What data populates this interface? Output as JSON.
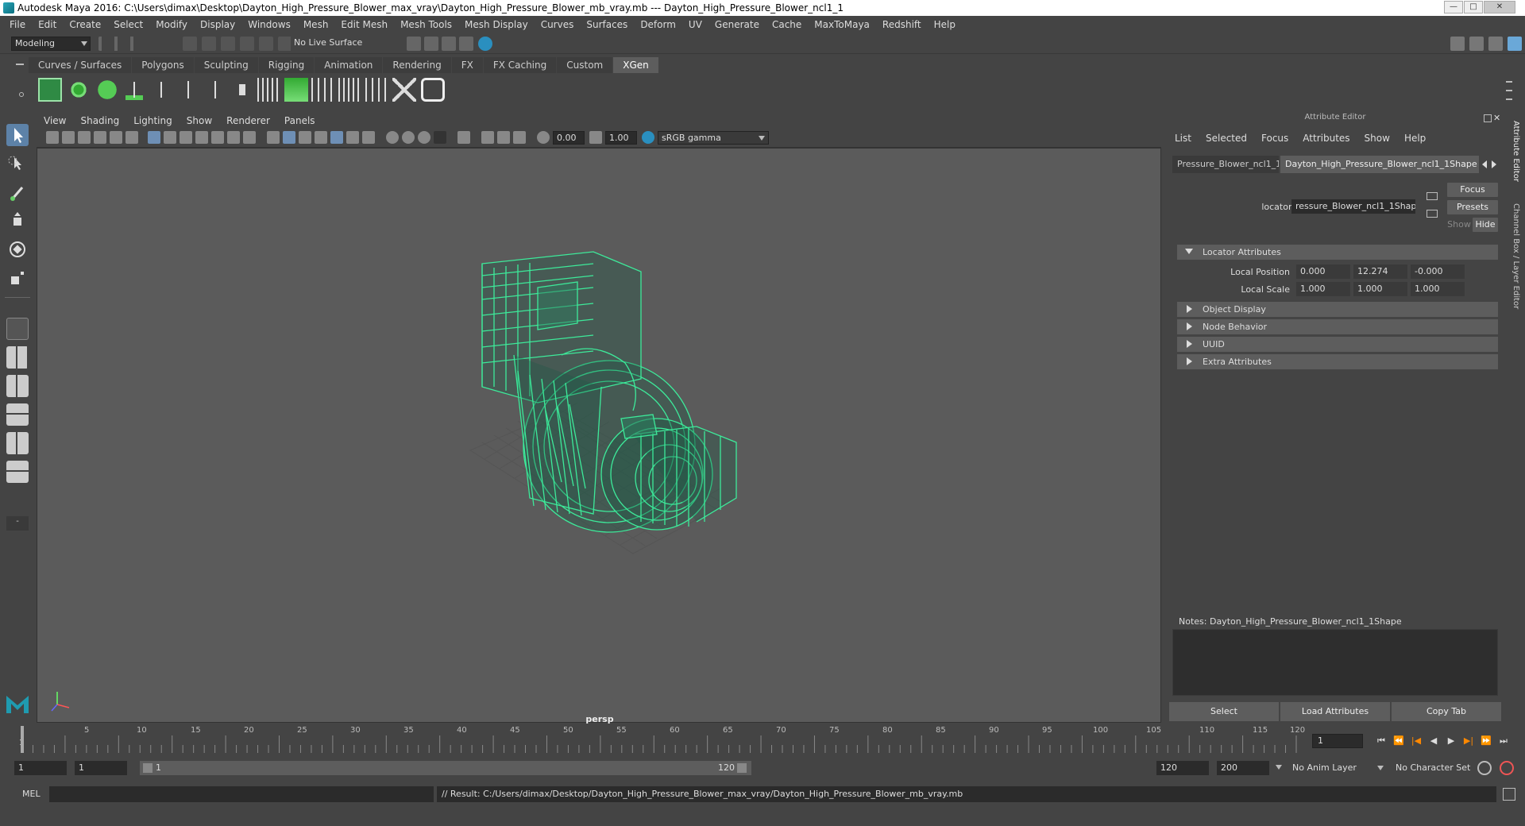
{
  "window": {
    "title": "Autodesk Maya 2016: C:\\Users\\dimax\\Desktop\\Dayton_High_Pressure_Blower_max_vray\\Dayton_High_Pressure_Blower_mb_vray.mb   ---   Dayton_High_Pressure_Blower_ncl1_1",
    "minimize": "—",
    "maximize": "□",
    "close": "✕"
  },
  "menubar": [
    "File",
    "Edit",
    "Create",
    "Select",
    "Modify",
    "Display",
    "Windows",
    "Mesh",
    "Edit Mesh",
    "Mesh Tools",
    "Mesh Display",
    "Curves",
    "Surfaces",
    "Deform",
    "UV",
    "Generate",
    "Cache",
    "MaxToMaya",
    "Redshift",
    "Help"
  ],
  "status": {
    "mode": "Modeling",
    "live_surface": "No Live Surface"
  },
  "shelf_tabs": [
    "Curves / Surfaces",
    "Polygons",
    "Sculpting",
    "Rigging",
    "Animation",
    "Rendering",
    "FX",
    "FX Caching",
    "Custom",
    "XGen"
  ],
  "shelf_active": "XGen",
  "viewport": {
    "menu": [
      "View",
      "Shading",
      "Lighting",
      "Show",
      "Renderer",
      "Panels"
    ],
    "exposure": "0.00",
    "gamma": "1.00",
    "color_space": "sRGB gamma",
    "camera_label": "persp"
  },
  "attr_editor": {
    "title": "Attribute Editor",
    "menu": [
      "List",
      "Selected",
      "Focus",
      "Attributes",
      "Show",
      "Help"
    ],
    "tab1": "Pressure_Blower_ncl1_1",
    "tab2": "Dayton_High_Pressure_Blower_ncl1_1Shape",
    "locator_label": "locator:",
    "locator_value": "ressure_Blower_ncl1_1Shape",
    "btn_focus": "Focus",
    "btn_presets": "Presets",
    "btn_show": "Show",
    "btn_hide": "Hide",
    "sections": {
      "locator_attrs": "Locator Attributes",
      "object_display": "Object Display",
      "node_behavior": "Node Behavior",
      "uuid": "UUID",
      "extra": "Extra Attributes"
    },
    "local_position_label": "Local Position",
    "local_position": [
      "0.000",
      "12.274",
      "-0.000"
    ],
    "local_scale_label": "Local Scale",
    "local_scale": [
      "1.000",
      "1.000",
      "1.000"
    ],
    "notes_label": "Notes:  Dayton_High_Pressure_Blower_ncl1_1Shape",
    "btn_select": "Select",
    "btn_load": "Load Attributes",
    "btn_copy": "Copy Tab"
  },
  "side_tabs": [
    "Attribute Editor",
    "Channel Box / Layer Editor"
  ],
  "timeline": {
    "ticks": [
      "5",
      "10",
      "15",
      "20",
      "25",
      "30",
      "35",
      "40",
      "45",
      "50",
      "55",
      "60",
      "65",
      "70",
      "75",
      "80",
      "85",
      "90",
      "95",
      "100",
      "105",
      "110",
      "115",
      "120"
    ],
    "current_frame": "1",
    "start_label": "1"
  },
  "range": {
    "start": "1",
    "playback_start": "1",
    "slider_start": "1",
    "slider_end": "120",
    "playback_end": "120",
    "end": "200",
    "anim_layer": "No Anim Layer",
    "char_set": "No Character Set"
  },
  "cmd": {
    "lang": "MEL",
    "result": "// Result: C:/Users/dimax/Desktop/Dayton_High_Pressure_Blower_max_vray/Dayton_High_Pressure_Blower_mb_vray.mb"
  },
  "colors": {
    "wireframe": "#3dea9a",
    "accent_tab": "#5d5d5d",
    "maya_teal": "#1f9bb0"
  }
}
